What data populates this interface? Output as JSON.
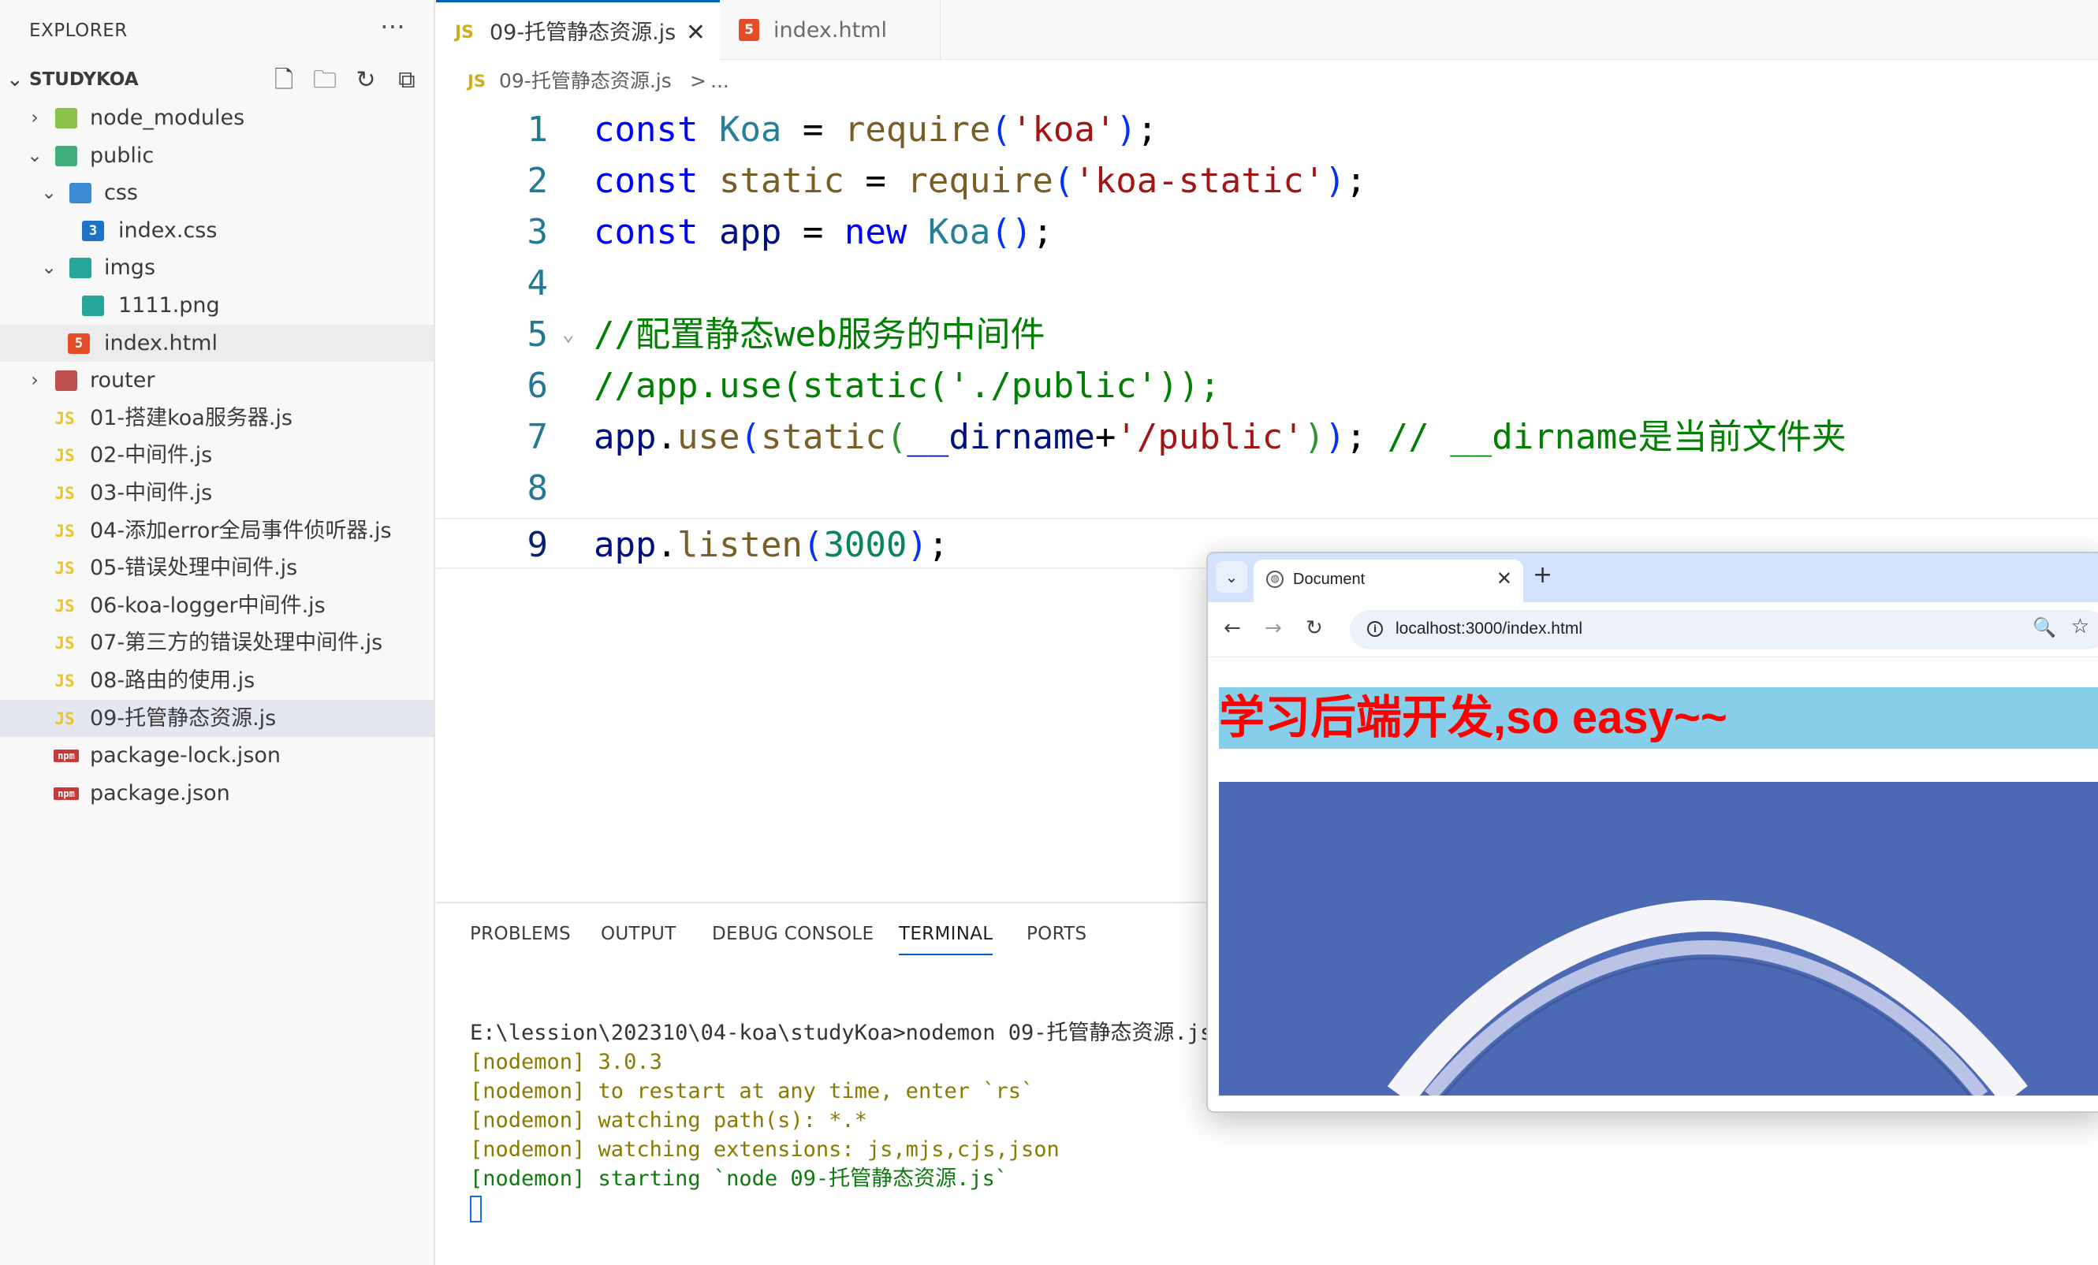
{
  "explorer": {
    "title": "EXPLORER",
    "more_icon": "ellipsis-icon",
    "section_title": "STUDYKOA",
    "actions": [
      "new-file-icon",
      "new-folder-icon",
      "refresh-icon",
      "collapse-all-icon"
    ],
    "items": [
      {
        "label": "node_modules",
        "type": "folder",
        "state": "collapsed",
        "icon": "folder-node-icon"
      },
      {
        "label": "public",
        "type": "folder",
        "state": "expanded",
        "icon": "folder-public-icon"
      },
      {
        "label": "css",
        "type": "folder",
        "state": "expanded",
        "icon": "folder-css-icon"
      },
      {
        "label": "index.css",
        "type": "file",
        "icon": "css-file-icon"
      },
      {
        "label": "imgs",
        "type": "folder",
        "state": "expanded",
        "icon": "folder-images-icon"
      },
      {
        "label": "1111.png",
        "type": "file",
        "icon": "image-file-icon"
      },
      {
        "label": "index.html",
        "type": "file",
        "icon": "html-file-icon"
      },
      {
        "label": "router",
        "type": "folder",
        "state": "collapsed",
        "icon": "folder-router-icon"
      },
      {
        "label": "01-搭建koa服务器.js",
        "type": "file",
        "icon": "js-file-icon"
      },
      {
        "label": "02-中间件.js",
        "type": "file",
        "icon": "js-file-icon"
      },
      {
        "label": "03-中间件.js",
        "type": "file",
        "icon": "js-file-icon"
      },
      {
        "label": "04-添加error全局事件侦听器.js",
        "type": "file",
        "icon": "js-file-icon"
      },
      {
        "label": "05-错误处理中间件.js",
        "type": "file",
        "icon": "js-file-icon"
      },
      {
        "label": "06-koa-logger中间件.js",
        "type": "file",
        "icon": "js-file-icon"
      },
      {
        "label": "07-第三方的错误处理中间件.js",
        "type": "file",
        "icon": "js-file-icon"
      },
      {
        "label": "08-路由的使用.js",
        "type": "file",
        "icon": "js-file-icon"
      },
      {
        "label": "09-托管静态资源.js",
        "type": "file",
        "icon": "js-file-icon",
        "selected": true
      },
      {
        "label": "package-lock.json",
        "type": "file",
        "icon": "npm-file-icon"
      },
      {
        "label": "package.json",
        "type": "file",
        "icon": "npm-file-icon"
      }
    ],
    "icon_text": {
      "js": "JS",
      "html": "5",
      "css": "3",
      "npm": "npm"
    }
  },
  "editor": {
    "tabs": [
      {
        "label": "09-托管静态资源.js",
        "icon": "js-file-icon",
        "active": true,
        "close": "✕"
      },
      {
        "label": "index.html",
        "icon": "html-file-icon",
        "active": false
      }
    ],
    "breadcrumb": {
      "file": "09-托管静态资源.js",
      "separator": ">",
      "more": "..."
    },
    "lines": [
      {
        "n": "1",
        "tokens": [
          [
            "kw",
            "const"
          ],
          [
            "plain",
            " "
          ],
          [
            "cls",
            "Koa"
          ],
          [
            "plain",
            " = "
          ],
          [
            "fn",
            "require"
          ],
          [
            "p1",
            "("
          ],
          [
            "str",
            "'koa'"
          ],
          [
            "p1",
            ")"
          ],
          [
            "plain",
            ";"
          ]
        ]
      },
      {
        "n": "2",
        "tokens": [
          [
            "kw",
            "const"
          ],
          [
            "plain",
            " "
          ],
          [
            "fn",
            "static"
          ],
          [
            "plain",
            " = "
          ],
          [
            "fn",
            "require"
          ],
          [
            "p1",
            "("
          ],
          [
            "str",
            "'koa-static'"
          ],
          [
            "p1",
            ")"
          ],
          [
            "plain",
            ";"
          ]
        ]
      },
      {
        "n": "3",
        "tokens": [
          [
            "kw",
            "const"
          ],
          [
            "plain",
            " "
          ],
          [
            "var",
            "app"
          ],
          [
            "plain",
            " = "
          ],
          [
            "kw",
            "new"
          ],
          [
            "plain",
            " "
          ],
          [
            "cls",
            "Koa"
          ],
          [
            "p1",
            "()"
          ],
          [
            "plain",
            ";"
          ]
        ]
      },
      {
        "n": "4",
        "tokens": []
      },
      {
        "n": "5",
        "fold": true,
        "tokens": [
          [
            "cmt",
            "//配置静态web服务的中间件"
          ]
        ]
      },
      {
        "n": "6",
        "tokens": [
          [
            "cmt",
            "//app.use(static('./public'));"
          ]
        ]
      },
      {
        "n": "7",
        "tokens": [
          [
            "var",
            "app"
          ],
          [
            "plain",
            "."
          ],
          [
            "fn",
            "use"
          ],
          [
            "p1",
            "("
          ],
          [
            "fn",
            "static"
          ],
          [
            "p2",
            "("
          ],
          [
            "var",
            "__dirname"
          ],
          [
            "plain",
            "+"
          ],
          [
            "str",
            "'/public'"
          ],
          [
            "p2",
            ")"
          ],
          [
            "p1",
            ")"
          ],
          [
            "plain",
            "; "
          ],
          [
            "cmt",
            "// __dirname是当前文件夹"
          ]
        ]
      },
      {
        "n": "8",
        "tokens": []
      },
      {
        "n": "9",
        "current": true,
        "tokens": [
          [
            "var",
            "app"
          ],
          [
            "plain",
            "."
          ],
          [
            "fn",
            "listen"
          ],
          [
            "p1",
            "("
          ],
          [
            "num",
            "3000"
          ],
          [
            "p1",
            ")"
          ],
          [
            "plain",
            ";"
          ]
        ]
      }
    ]
  },
  "panel": {
    "tabs": [
      "PROBLEMS",
      "OUTPUT",
      "DEBUG CONSOLE",
      "TERMINAL",
      "PORTS"
    ],
    "active_tab": "TERMINAL",
    "terminal": {
      "prompt": "E:\\lession\\202310\\04-koa\\studyKoa>nodemon 09-托管静态资源.js",
      "lines": [
        {
          "text": "[nodemon] 3.0.3",
          "color": "gold"
        },
        {
          "text": "[nodemon] to restart at any time, enter `rs`",
          "color": "gold"
        },
        {
          "text": "[nodemon] watching path(s): *.*",
          "color": "gold"
        },
        {
          "text": "[nodemon] watching extensions: js,mjs,cjs,json",
          "color": "gold"
        },
        {
          "text": "[nodemon] starting `node 09-托管静态资源.js`",
          "color": "green"
        }
      ]
    }
  },
  "browser": {
    "tab_title": "Document",
    "tab_close": "✕",
    "new_tab": "+",
    "url": "localhost:3000/index.html",
    "page": {
      "heading": "学习后端开发,so easy~~",
      "heading_color": "#ff0000",
      "heading_bg": "#87ceeb",
      "image_bg": "#4c6ab3"
    }
  },
  "colors": {
    "accent": "#005fb8",
    "keyword": "#0000ff",
    "comment": "#008000",
    "string": "#a31515"
  }
}
